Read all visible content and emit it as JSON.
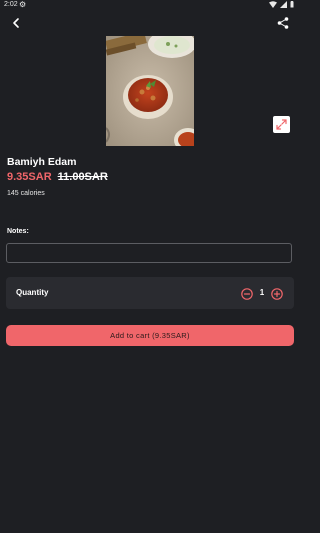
{
  "status_bar": {
    "time": "2:02"
  },
  "icons": {
    "back": "arrow-left-icon",
    "share": "share-icon",
    "expand": "expand-icon",
    "minus": "minus-circle-icon",
    "plus": "plus-circle-icon"
  },
  "product": {
    "name": "Bamiyh Edam",
    "price": "9.35SAR",
    "old_price": "11.00SAR",
    "calories": "145 calories"
  },
  "notes": {
    "label": "Notes:",
    "value": "",
    "placeholder": ""
  },
  "quantity": {
    "label": "Quantity",
    "value": "1"
  },
  "cart": {
    "button_label": "Add to cart (9.35SAR)"
  },
  "colors": {
    "accent": "#f0666a",
    "background": "#1e1f23",
    "card": "#2a2b30"
  }
}
